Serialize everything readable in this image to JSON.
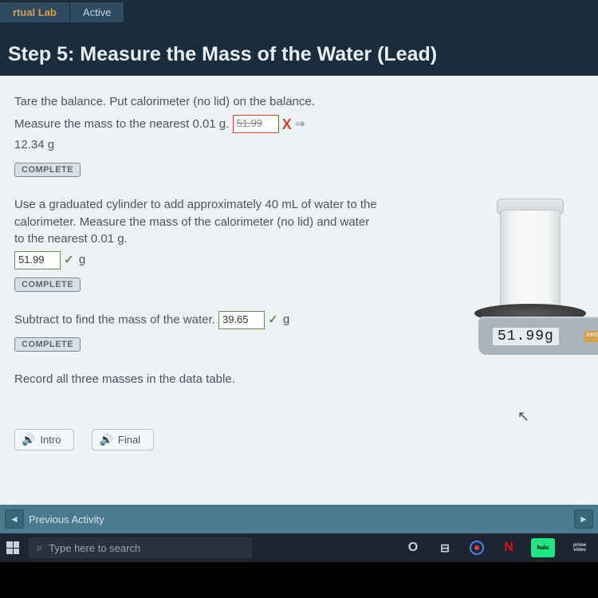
{
  "tabs": {
    "lab": "rtual Lab",
    "active": "Active"
  },
  "title": "Step 5: Measure the Mass of the Water (Lead)",
  "step1": {
    "line1": "Tare the balance. Put calorimeter (no lid) on the balance.",
    "line2_pre": "Measure the mass to the nearest 0.01 g.",
    "input": "51.99",
    "corrected": "12.34 g"
  },
  "step2": {
    "text": "Use a graduated cylinder to add approximately 40 mL of water to the calorimeter. Measure the mass of the calorimeter (no lid) and water to the nearest 0.01 g.",
    "input": "51.99",
    "unit": "g"
  },
  "step3": {
    "text": "Subtract to find the mass of the water.",
    "input": "39.65",
    "unit": "g"
  },
  "step4": {
    "text": "Record all three masses in the data table."
  },
  "complete_label": "COMPLETE",
  "balance": {
    "readout": "51.99g",
    "zero": "zero"
  },
  "media": {
    "intro": "Intro",
    "final": "Final"
  },
  "footer": {
    "prev": "Previous Activity"
  },
  "taskbar": {
    "search_placeholder": "Type here to search",
    "netflix": "N",
    "hulu": "hulu",
    "prime": "prime video"
  }
}
